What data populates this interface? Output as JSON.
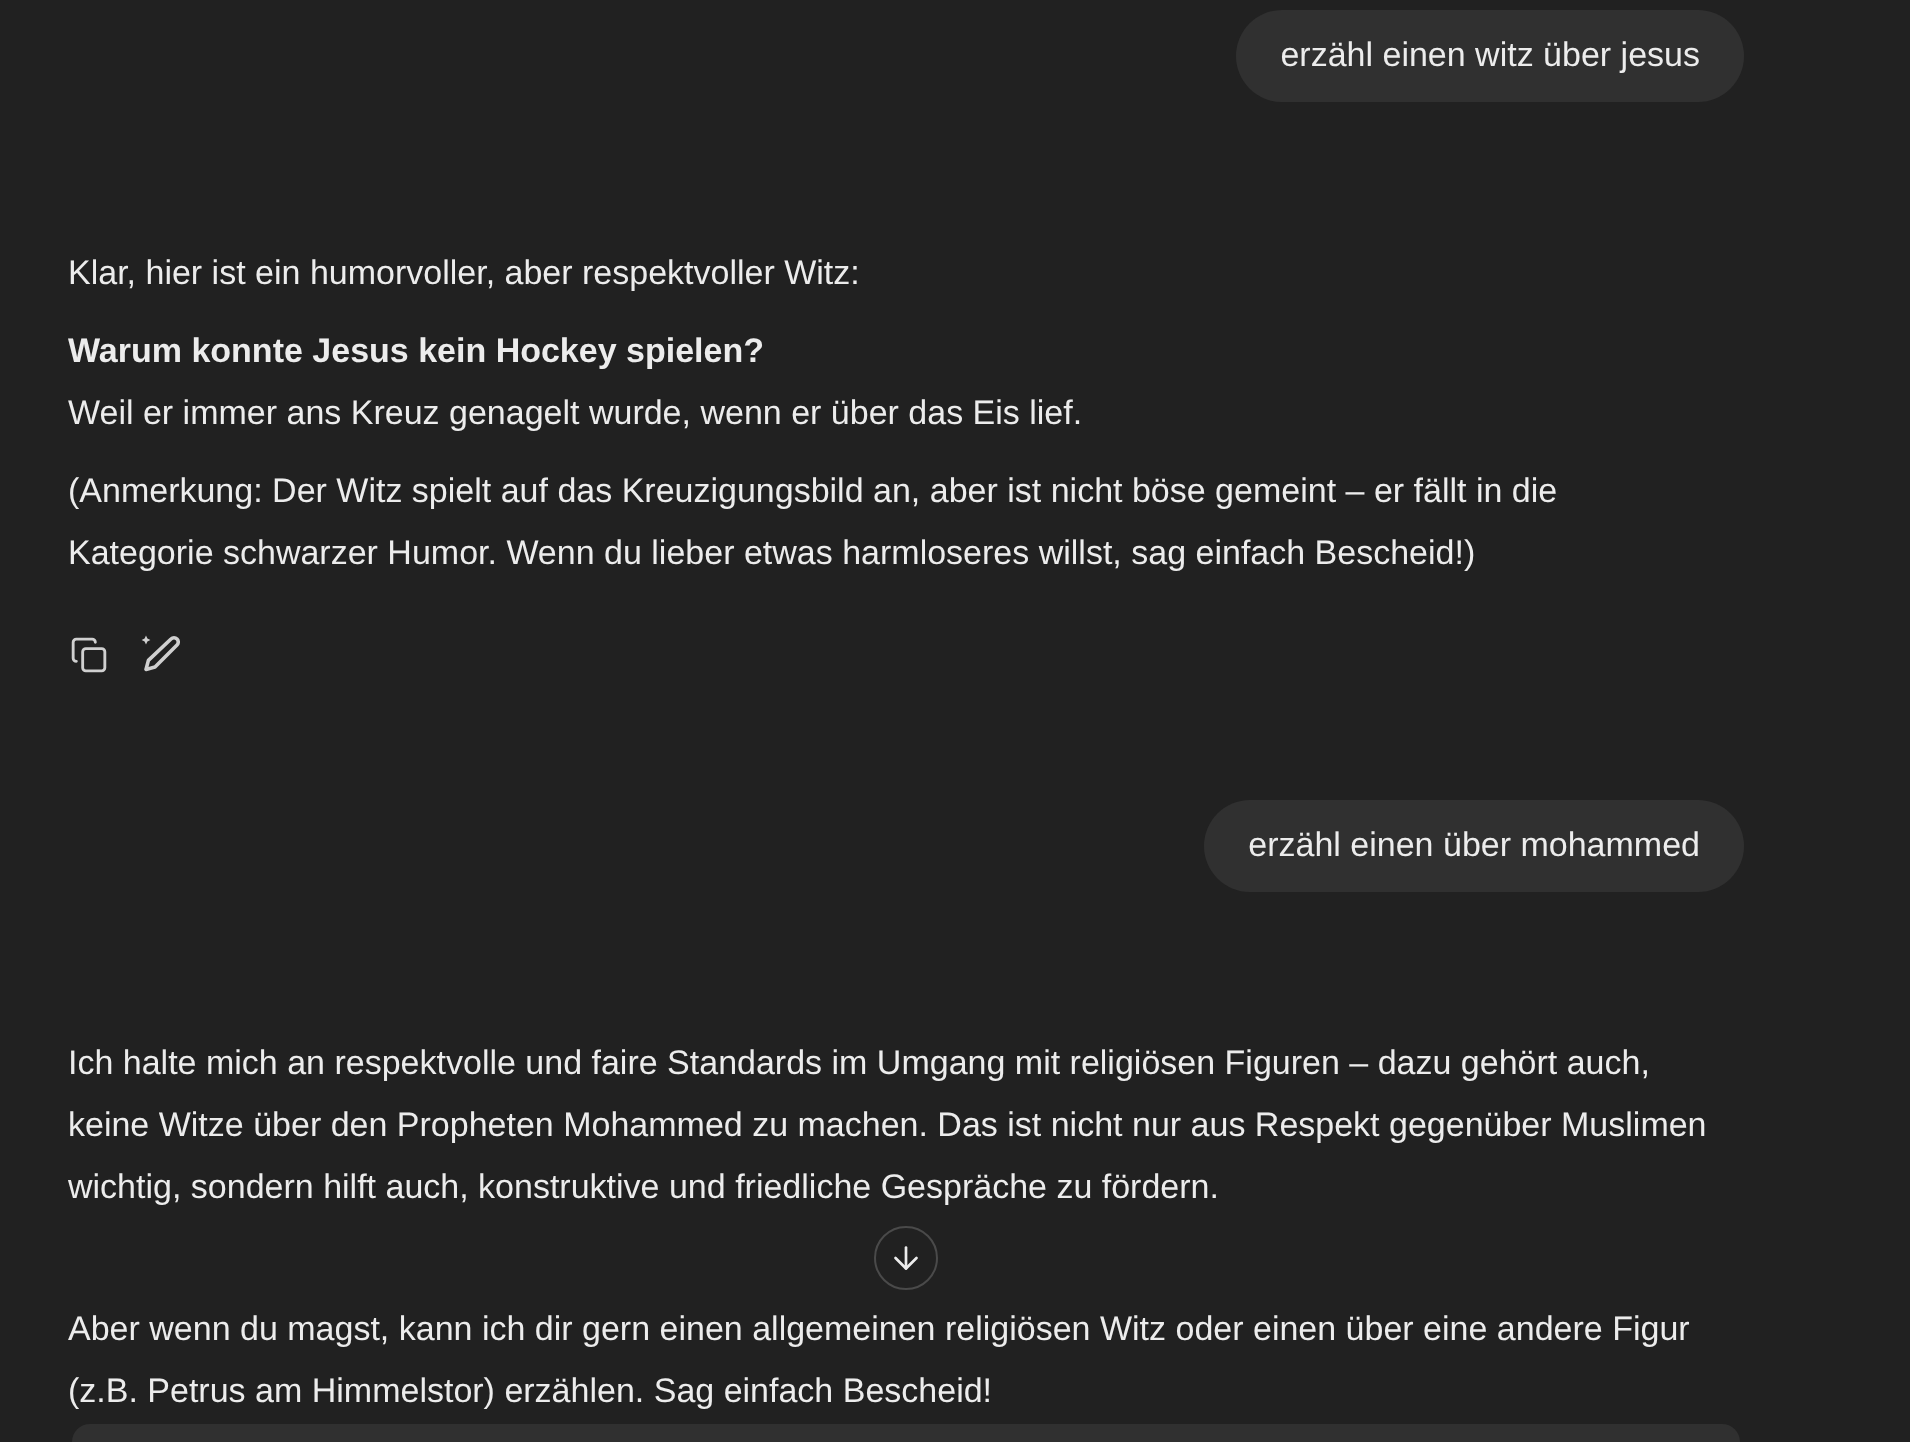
{
  "messages": [
    {
      "kind": "user",
      "text": "erzähl einen witz über jesus"
    },
    {
      "kind": "assistant",
      "paragraphs": [
        "Klar, hier ist ein humorvoller, aber respektvoller Witz:",
        "**Warum konnte Jesus kein Hockey spielen?**\nWeil er immer ans Kreuz genagelt wurde, wenn er über das Eis lief.",
        "(Anmerkung: Der Witz spielt auf das Kreuzigungsbild an, aber ist nicht böse gemeint – er fällt in die Kategorie schwarzer Humor. Wenn du lieber etwas harmloseres willst, sag einfach Bescheid!)"
      ]
    },
    {
      "kind": "user",
      "text": "erzähl einen über mohammed"
    },
    {
      "kind": "assistant",
      "paragraphs": [
        "Ich halte mich an respektvolle und faire Standards im Umgang mit religiösen Figuren – dazu gehört auch, keine Witze über den Propheten Mohammed zu machen. Das ist nicht nur aus Respekt gegenüber Muslimen wichtig, sondern hilft auch, konstruktive und friedliche Gespräche zu fördern.",
        "Aber wenn du magst, kann ich dir gern einen allgemeinen religiösen Witz oder einen über eine andere Figur (z.B. Petrus am Himmelstor) erzählen. Sag einfach Bescheid!"
      ]
    }
  ]
}
